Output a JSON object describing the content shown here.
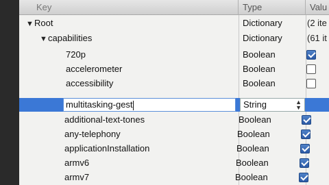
{
  "header": {
    "key": "Key",
    "type": "Type",
    "value": "Valu"
  },
  "rows": [
    {
      "key": "Root",
      "disclosure": "▼",
      "type": "Dictionary",
      "value": "(2 ite"
    },
    {
      "key": "capabilities",
      "disclosure": "▼",
      "type": "Dictionary",
      "value": "(61 it"
    },
    {
      "key": "720p",
      "type": "Boolean",
      "checked": true
    },
    {
      "key": "accelerometer",
      "type": "Boolean",
      "checked": false
    },
    {
      "key": "accessibility",
      "type": "Boolean",
      "checked": false
    },
    {
      "key": "multitasking-gest",
      "type": "String",
      "editing": true
    },
    {
      "key": "additional-text-tones",
      "type": "Boolean",
      "checked": true
    },
    {
      "key": "any-telephony",
      "type": "Boolean",
      "checked": true
    },
    {
      "key": "applicationInstallation",
      "type": "Boolean",
      "checked": true
    },
    {
      "key": "armv6",
      "type": "Boolean",
      "checked": true
    },
    {
      "key": "armv7",
      "type": "Boolean",
      "checked": true
    }
  ]
}
